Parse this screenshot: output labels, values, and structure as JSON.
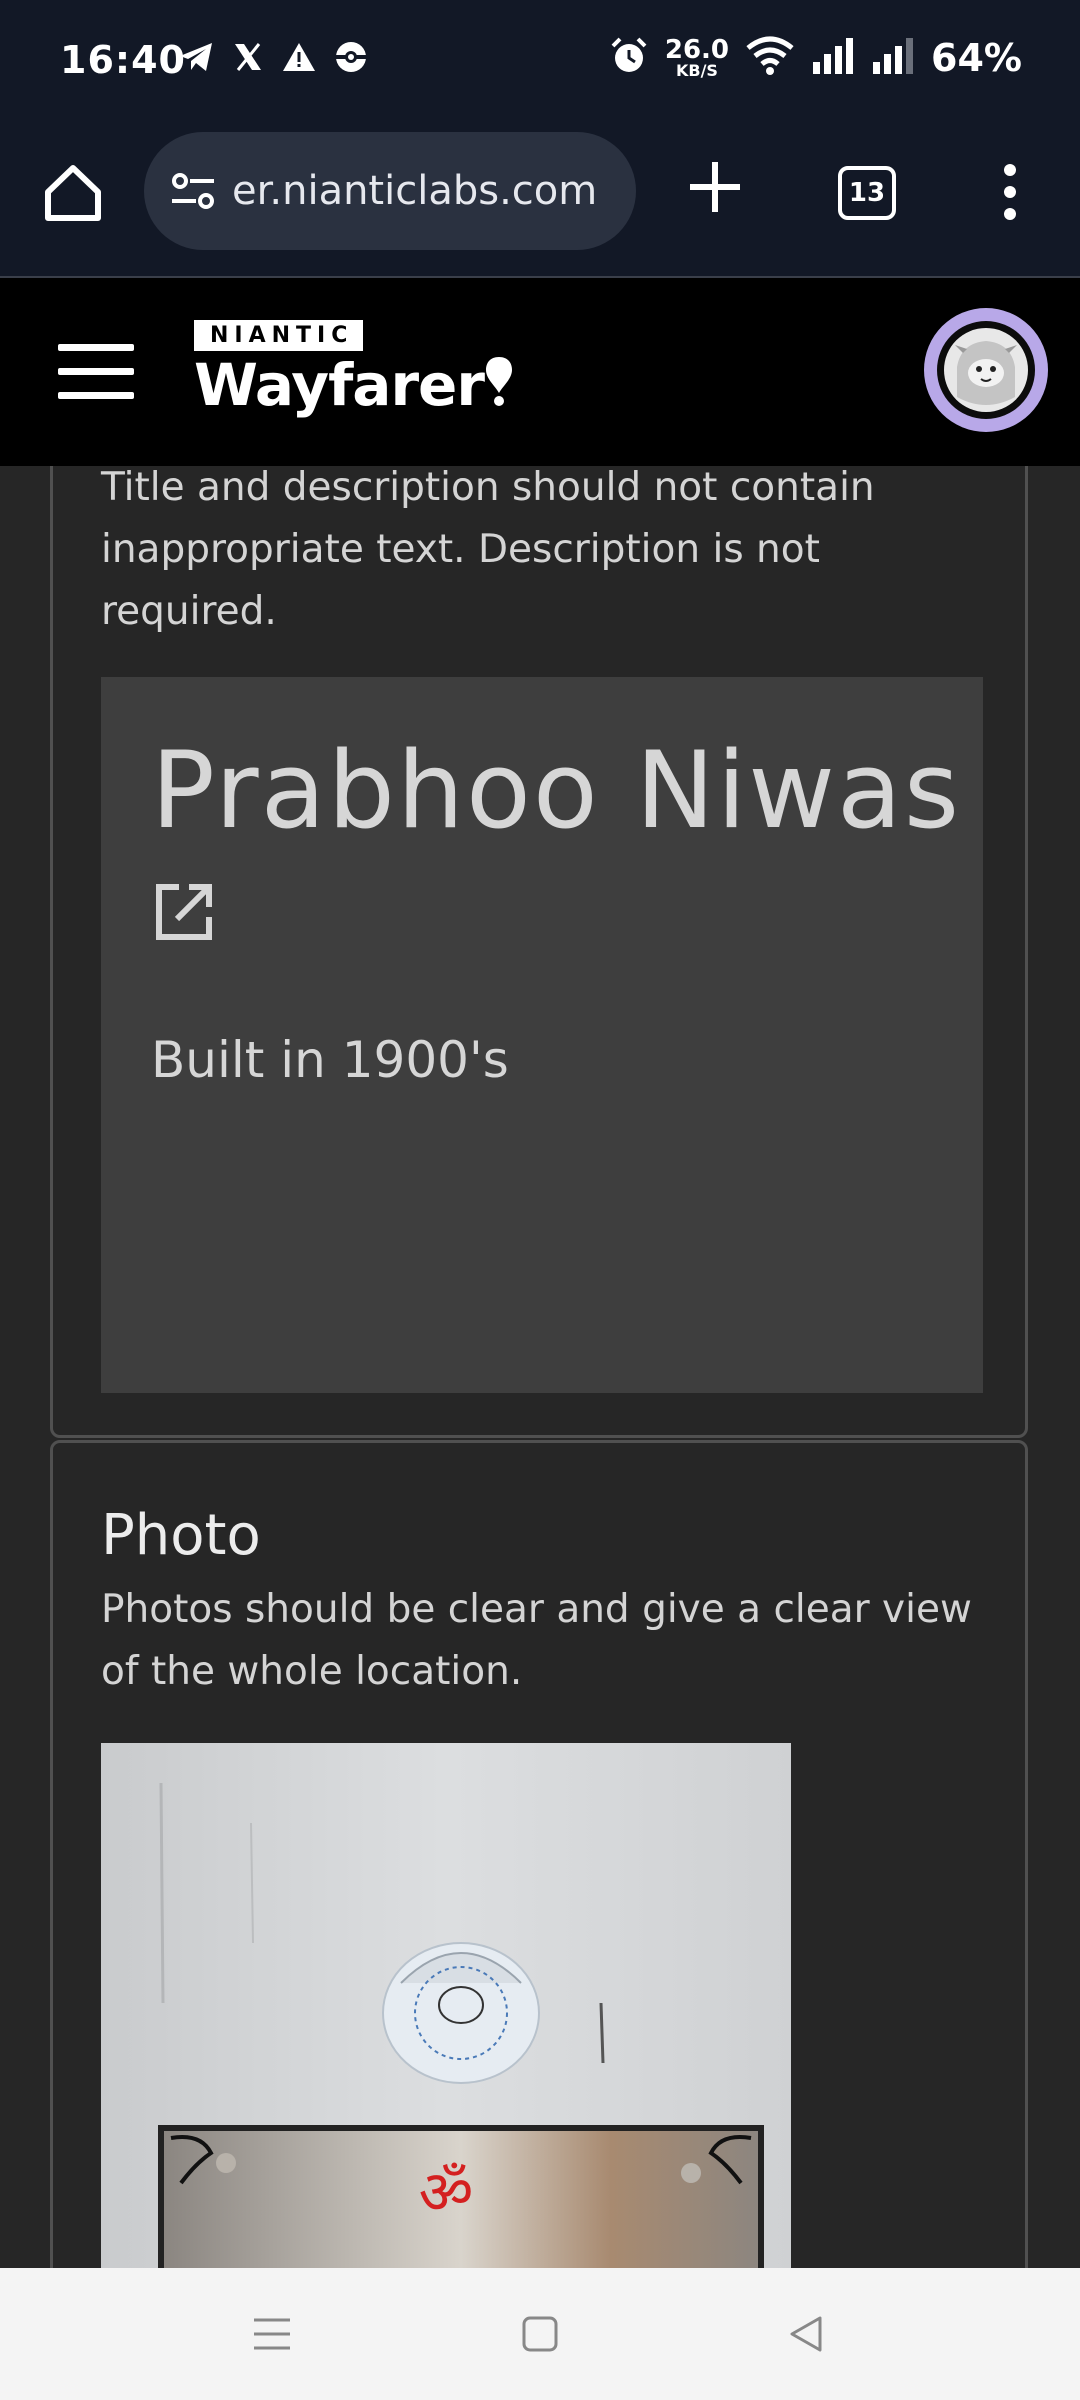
{
  "status_bar": {
    "time": "16:40",
    "left_icons": [
      "telegram-icon",
      "x-icon",
      "alert-icon",
      "pokeball-icon"
    ],
    "speed_value": "26.0",
    "speed_unit": "KB/S",
    "battery": "64%"
  },
  "browser": {
    "url": "er.nianticlabs.com",
    "tab_count": "13"
  },
  "app_header": {
    "brand_small": "NIANTIC",
    "brand_large": "Wayfarer"
  },
  "title_card": {
    "description": "Title and description should not contain inappropriate text. Description is not required.",
    "poi_title": "Prabhoo Niwas",
    "poi_description": "Built in 1900's"
  },
  "photo_card": {
    "heading": "Photo",
    "description": "Photos should be clear and give a clear view of the whole location."
  },
  "colors": {
    "status_bg": "#121826",
    "header_bg": "#000000",
    "content_bg": "#262626",
    "title_box_bg": "#3e3e3e",
    "avatar_ring": "#b8a8e8",
    "om_red": "#d42020"
  }
}
